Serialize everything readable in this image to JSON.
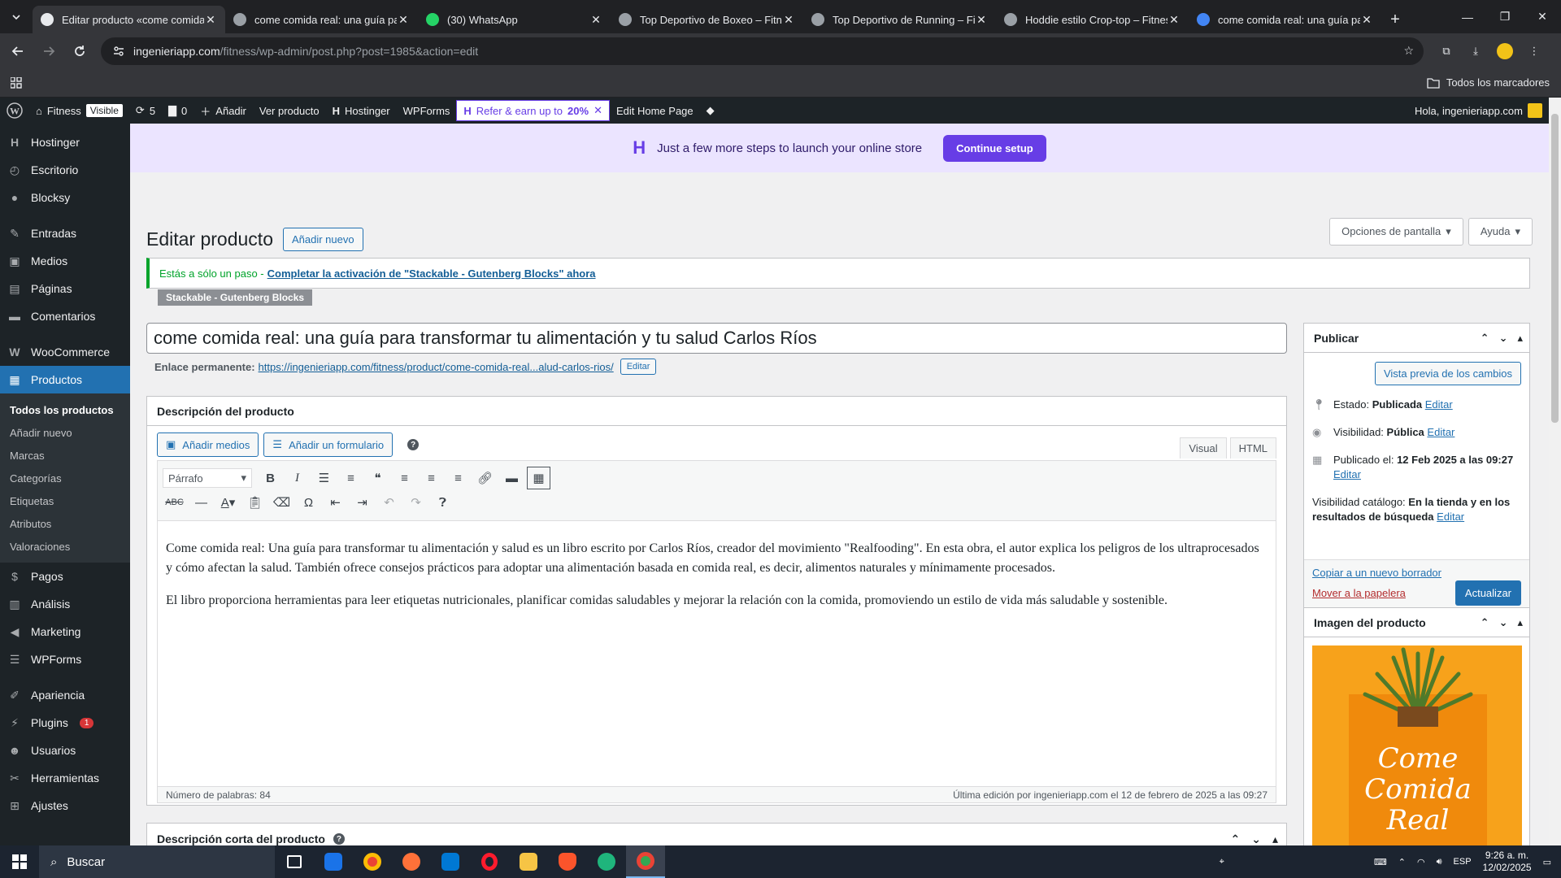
{
  "browser": {
    "tabs": [
      {
        "title": "Editar producto «come comida real: una guía...",
        "favicon": "wordpress-icon",
        "active": true
      },
      {
        "title": "come comida real: una guía para...",
        "favicon": "globe-icon",
        "active": false
      },
      {
        "title": "(30) WhatsApp",
        "favicon": "whatsapp-icon",
        "active": false
      },
      {
        "title": "Top Deportivo de Boxeo – Fitness",
        "favicon": "globe-icon",
        "active": false
      },
      {
        "title": "Top Deportivo de Running – Fitness",
        "favicon": "globe-icon",
        "active": false
      },
      {
        "title": "Hoddie estilo Crop-top – Fitness",
        "favicon": "globe-icon",
        "active": false
      },
      {
        "title": "come comida real: una guía para...",
        "favicon": "chrome-icon",
        "active": false
      }
    ],
    "url_host": "ingenieriapp.com",
    "url_path": "/fitness/wp-admin/post.php?post=1985&action=edit",
    "bookmarks_all": "Todos los marcadores"
  },
  "adminbar": {
    "site_name": "Fitness",
    "visible_badge": "Visible",
    "updates_count": "5",
    "comments_count": "0",
    "add_new": "Añadir",
    "view_product": "Ver producto",
    "hostinger": "Hostinger",
    "wpforms": "WPForms",
    "refer_text": "Refer & earn up to",
    "refer_pct": "20%",
    "edit_home": "Edit Home Page",
    "greeting": "Hola, ingenieriapp.com"
  },
  "menu": {
    "items": [
      {
        "label": "Hostinger",
        "icon": "hostinger-icon"
      },
      {
        "label": "Escritorio",
        "icon": "dashboard-icon"
      },
      {
        "label": "Blocksy",
        "icon": "blocksy-icon"
      },
      {
        "label": "Entradas",
        "icon": "pin-icon"
      },
      {
        "label": "Medios",
        "icon": "media-icon"
      },
      {
        "label": "Páginas",
        "icon": "pages-icon"
      },
      {
        "label": "Comentarios",
        "icon": "comments-icon"
      },
      {
        "label": "WooCommerce",
        "icon": "woocommerce-icon"
      },
      {
        "label": "Productos",
        "icon": "products-icon"
      },
      {
        "label": "Pagos",
        "icon": "payments-icon"
      },
      {
        "label": "Análisis",
        "icon": "analytics-icon"
      },
      {
        "label": "Marketing",
        "icon": "megaphone-icon"
      },
      {
        "label": "WPForms",
        "icon": "wpforms-icon"
      },
      {
        "label": "Apariencia",
        "icon": "brush-icon"
      },
      {
        "label": "Plugins",
        "icon": "plugin-icon"
      },
      {
        "label": "Usuarios",
        "icon": "users-icon"
      },
      {
        "label": "Herramientas",
        "icon": "tools-icon"
      },
      {
        "label": "Ajustes",
        "icon": "settings-icon"
      }
    ],
    "plugins_count": "1",
    "submenu": [
      "Todos los productos",
      "Añadir nuevo",
      "Marcas",
      "Categorías",
      "Etiquetas",
      "Atributos",
      "Valoraciones"
    ]
  },
  "banner": {
    "text": "Just a few more steps to launch your online store",
    "button": "Continue setup"
  },
  "page": {
    "title": "Editar producto",
    "add_new": "Añadir nuevo",
    "screen_options": "Opciones de pantalla",
    "help": "Ayuda",
    "notice_prefix": "Estás a sólo un paso -",
    "notice_link": "Completar la activación de \"Stackable - Gutenberg Blocks\" ahora",
    "notice_tag": "Stackable - Gutenberg Blocks",
    "product_title": "come comida real: una guía para transformar tu alimentación y tu salud Carlos Ríos",
    "permalink_label": "Enlace permanente:",
    "permalink_base": "https://ingenieriapp.com/fitness/product/",
    "permalink_slug": "come-comida-real...alud-carlos-rios/",
    "permalink_edit": "Editar"
  },
  "description": {
    "heading": "Descripción del producto",
    "add_media": "Añadir medios",
    "add_form": "Añadir un formulario",
    "tab_visual": "Visual",
    "tab_html": "HTML",
    "format_select": "Párrafo",
    "paragraph1": "Come comida real: Una guía para transformar tu alimentación y salud es un libro escrito por Carlos Ríos, creador del movimiento \"Realfooding\". En esta obra, el autor explica los peligros de los ultraprocesados y cómo afectan la salud. También ofrece consejos prácticos para adoptar una alimentación basada en comida real, es decir, alimentos naturales y mínimamente procesados.",
    "paragraph2": "El libro proporciona herramientas para leer etiquetas nutricionales, planificar comidas saludables y mejorar la relación con la comida, promoviendo un estilo de vida más saludable y sostenible.",
    "word_count": "Número de palabras: 84",
    "last_edit": "Última edición por ingenieriapp.com el 12 de febrero de 2025 a las 09:27"
  },
  "short_description": {
    "heading": "Descripción corta del producto"
  },
  "publish": {
    "heading": "Publicar",
    "preview": "Vista previa de los cambios",
    "status_label": "Estado:",
    "status_value": "Publicada",
    "visibility_label": "Visibilidad:",
    "visibility_value": "Pública",
    "published_label": "Publicado el:",
    "published_value": "12 Feb 2025 a las 09:27",
    "catalog_label": "Visibilidad catálogo:",
    "catalog_value": "En la tienda y en los resultados de búsqueda",
    "edit": "Editar",
    "copy_draft": "Copiar a un nuevo borrador",
    "trash": "Mover a la papelera",
    "update": "Actualizar"
  },
  "product_image": {
    "heading": "Imagen del producto",
    "book_line1": "Come",
    "book_line2": "Comida",
    "book_line3": "Real"
  },
  "taskbar": {
    "search": "Buscar",
    "lang": "ESP",
    "time": "9:26 a. m.",
    "date": "12/02/2025"
  },
  "colors": {
    "wp_blue": "#2271b1",
    "admin_dark": "#1d2327",
    "hostinger_purple": "#673de6",
    "book_orange": "#f7a21b"
  }
}
